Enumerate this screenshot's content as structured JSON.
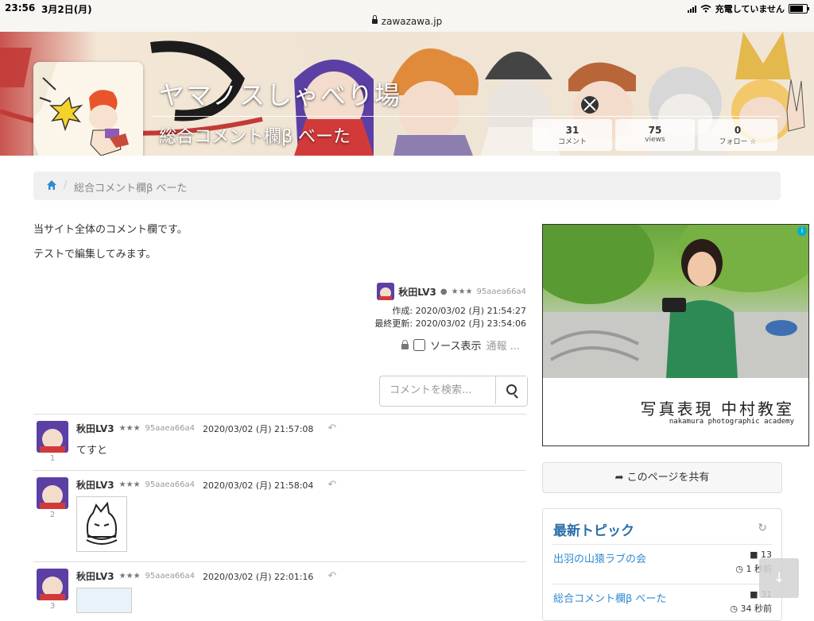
{
  "status_bar": {
    "time": "23:56",
    "date": "3月2日(月)",
    "url": "zawazawa.jp",
    "charging": "充電していません"
  },
  "banner": {
    "title": "ヤマノスしゃべり場",
    "subtitle": "総合コメント欄β べーた",
    "stats": [
      {
        "value": "31",
        "label": "コメント"
      },
      {
        "value": "75",
        "label": "views"
      },
      {
        "value": "0",
        "label": "フォロー ☆"
      }
    ]
  },
  "breadcrumb": {
    "separator": "/",
    "current": "総合コメント欄β べーた"
  },
  "description": {
    "line1": "当サイト全体のコメント欄です。",
    "line2": "テストで編集してみます。"
  },
  "author": {
    "name": "秋田LV3",
    "stars": "★★★",
    "id": "95aaea66a4",
    "created": "作成: 2020/03/02 (月) 21:54:27",
    "updated": "最終更新: 2020/03/02 (月) 23:54:06",
    "source_label": "ソース表示",
    "report_label": "通報 ..."
  },
  "search": {
    "placeholder": "コメントを検索..."
  },
  "comments": [
    {
      "num": "1",
      "name": "秋田LV3",
      "stars": "★★★",
      "id": "95aaea66a4",
      "date": "2020/03/02 (月) 21:57:08",
      "text": "てすと"
    },
    {
      "num": "2",
      "name": "秋田LV3",
      "stars": "★★★",
      "id": "95aaea66a4",
      "date": "2020/03/02 (月) 21:58:04",
      "text": ""
    },
    {
      "num": "3",
      "name": "秋田LV3",
      "stars": "★★★",
      "id": "95aaea66a4",
      "date": "2020/03/02 (月) 22:01:16",
      "text": ""
    }
  ],
  "ad": {
    "title": "写真表現 中村教室",
    "subtitle": "nakamura photographic academy",
    "info": "i"
  },
  "share": {
    "label": "このページを共有"
  },
  "topics": {
    "title": "最新トピック",
    "items": [
      {
        "title": "出羽の山猿ラブの会",
        "count": "13",
        "time": "1 秒前"
      },
      {
        "title": "総合コメント欄β べーた",
        "count": "31",
        "time": "34 秒前"
      }
    ]
  }
}
